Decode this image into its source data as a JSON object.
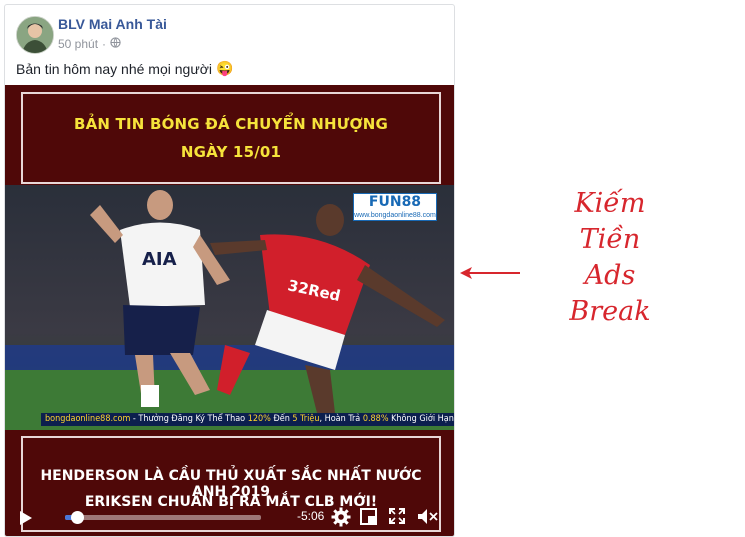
{
  "post": {
    "author": "BLV Mai Anh Tài",
    "time": "50 phút",
    "privacy_icon": "globe-icon",
    "text": "Bản tin hôm nay nhé mọi người",
    "emoji": "😜"
  },
  "video": {
    "title_line1": "BẢN TIN BÓNG ĐÁ CHUYỂN NHƯỢNG",
    "title_line2": "NGÀY 15/01",
    "logo_brand": "FUN88",
    "logo_site": "www.bongdaonline88.com",
    "promo": {
      "site": "bongdaonline88.com",
      "text1": " - Thưởng Đăng Ký Thể Thao ",
      "pct1": "120%",
      "text2": " Đến ",
      "amount": "5 Triệu",
      "text3": ", Hoàn Trả ",
      "pct2": "0.88%",
      "text4": " Không Giới Hạn"
    },
    "headline1": "HENDERSON LÀ CẦU THỦ XUẤT SẮC NHẤT NƯỚC ANH 2019",
    "headline2": "ERIKSEN CHUẨN BỊ RA MẮT CLB MỚI!",
    "time_remaining": "-5:06",
    "progress": 0.06,
    "jersey_text_left": "AIA",
    "jersey_text_right": "32Red"
  },
  "annotation": {
    "line1": "Kiếm Tiền",
    "line2": "Ads Break",
    "color": "#d7262d"
  }
}
